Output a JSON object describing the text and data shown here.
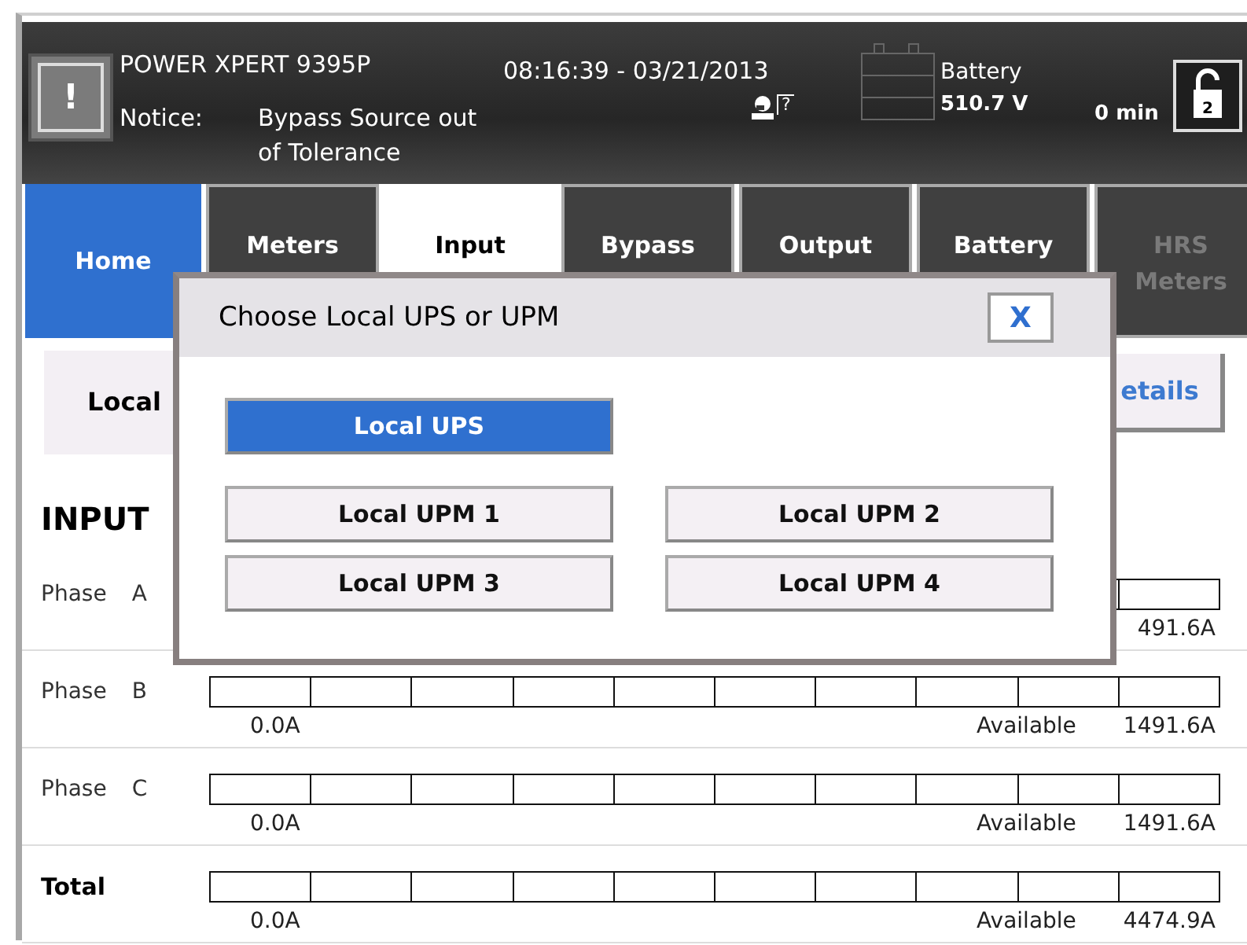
{
  "header": {
    "alert_button": "!",
    "title": "POWER XPERT 9395P",
    "datetime": "08:16:39 - 03/21/2013",
    "notice_label": "Notice:",
    "notice_text": "Bypass Source out of Tolerance",
    "help_mark": "?",
    "battery_label": "Battery",
    "battery_voltage": "510.7 V",
    "runtime": "0 min",
    "lock_level": "2"
  },
  "tabs": [
    {
      "kind": "home",
      "label": "Home",
      "selected": false,
      "disabled": false
    },
    {
      "kind": "tab",
      "label": "Meters",
      "selected": false,
      "disabled": false
    },
    {
      "kind": "tab",
      "label": "Input",
      "selected": true,
      "disabled": false
    },
    {
      "kind": "tab",
      "label": "Bypass",
      "selected": false,
      "disabled": false
    },
    {
      "kind": "tab",
      "label": "Output",
      "selected": false,
      "disabled": false
    },
    {
      "kind": "tab",
      "label": "Battery",
      "selected": false,
      "disabled": false
    },
    {
      "kind": "tab",
      "label": "HRS Meters",
      "selected": false,
      "disabled": true
    }
  ],
  "subbar": {
    "local_button": "Local",
    "details_button": "etails"
  },
  "section_title": "INPUT",
  "rows": [
    {
      "label": "Phase",
      "phase": "A",
      "max": "491.6A"
    },
    {
      "label": "Phase",
      "phase": "B",
      "min": "0.0A",
      "available_label": "Available",
      "max": "1491.6A"
    },
    {
      "label": "Phase",
      "phase": "C",
      "min": "0.0A",
      "available_label": "Available",
      "max": "1491.6A"
    },
    {
      "label": "Total",
      "total": true,
      "min": "0.0A",
      "available_label": "Available",
      "max": "4474.9A"
    }
  ],
  "dialog": {
    "title": "Choose Local UPS or UPM",
    "close": "X",
    "options": [
      {
        "label": "Local UPS",
        "selected": true
      },
      {
        "label": "Local UPM 1",
        "selected": false
      },
      {
        "label": "Local UPM 2",
        "selected": false
      },
      {
        "label": "Local UPM 3",
        "selected": false
      },
      {
        "label": "Local UPM 4",
        "selected": false
      }
    ]
  }
}
